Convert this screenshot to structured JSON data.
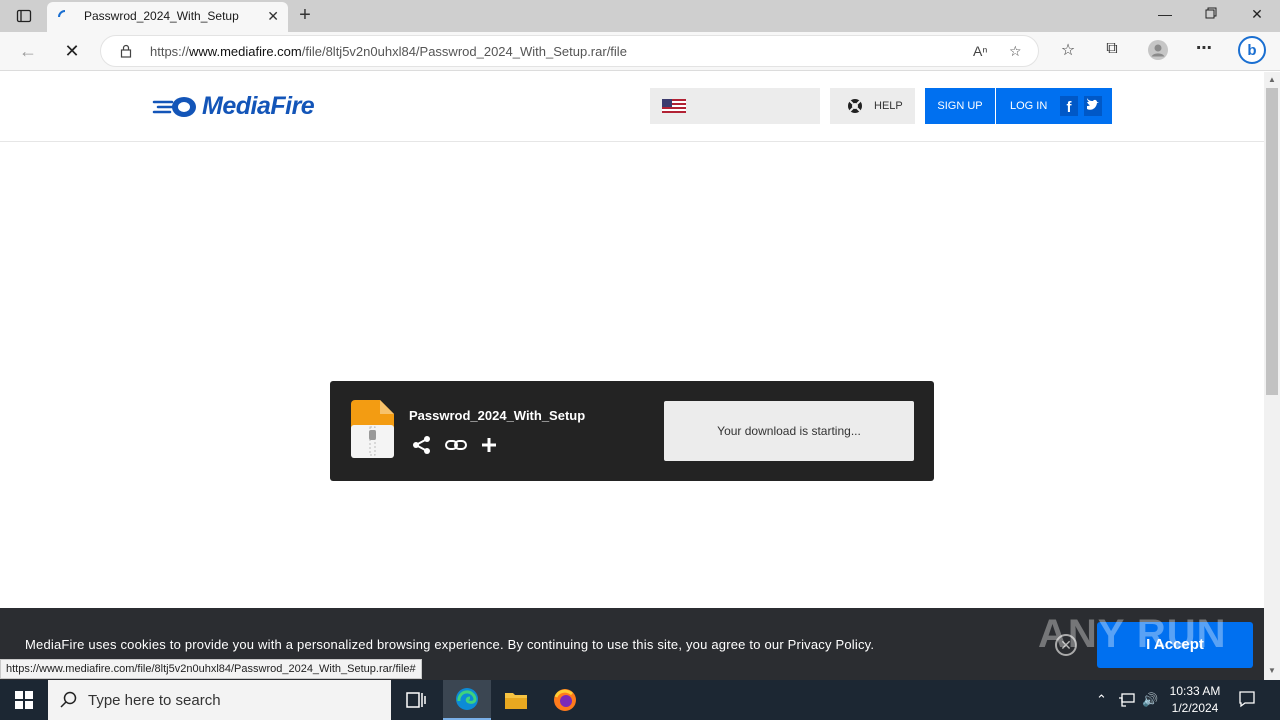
{
  "browser": {
    "tab_title": "Passwrod_2024_With_Setup",
    "new_tab_symbol": "+",
    "tab_close_symbol": "✕",
    "url_prefix": "https://",
    "url_host": "www.mediafire.com",
    "url_path": "/file/8ltj5v2n0uhxl84/Passwrod_2024_With_Setup.rar/file",
    "status_url": "https://www.mediafire.com/file/8ltj5v2n0uhxl84/Passwrod_2024_With_Setup.rar/file#",
    "window_controls": [
      "minimize",
      "restore",
      "close"
    ]
  },
  "site": {
    "logo_text": "MediaFire",
    "help_label": "HELP",
    "signup_label": "SIGN UP",
    "login_label": "LOG IN",
    "brand_color": "#0070f0"
  },
  "download": {
    "file_name": "Passwrod_2024_With_Setup",
    "status_text": "Your download is starting...",
    "actions": [
      "share-icon",
      "link-icon",
      "add-icon"
    ]
  },
  "cookie_bar": {
    "message": "MediaFire uses cookies to provide you with a personalized browsing experience. By continuing to use this site, you agree to our Privacy Policy.",
    "accept_label": "I Accept",
    "close_symbol": "✕"
  },
  "watermark": "ANY RUN",
  "taskbar": {
    "search_placeholder": "Type here to search",
    "time": "10:33 AM",
    "date": "1/2/2024",
    "apps": [
      "task-view",
      "edge",
      "file-explorer",
      "firefox"
    ]
  }
}
